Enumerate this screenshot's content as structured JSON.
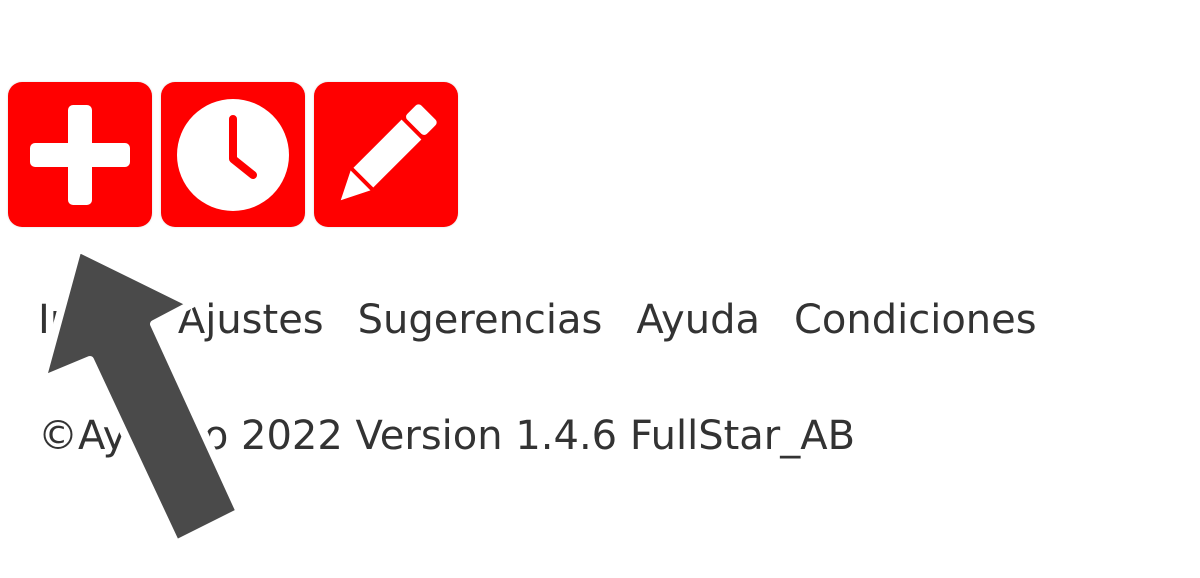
{
  "colors": {
    "button_bg": "#ff0000",
    "icon_fg": "#ffffff",
    "text": "#333333",
    "arrow_fill": "#4a4a4a",
    "arrow_stroke": "#ffffff"
  },
  "toolbar": {
    "buttons": [
      {
        "icon": "plus-icon"
      },
      {
        "icon": "clock-icon"
      },
      {
        "icon": "pencil-icon"
      }
    ]
  },
  "footer": {
    "links": [
      "Inicio",
      "Ajustes",
      "Sugerencias",
      "Ayuda",
      "Condiciones"
    ],
    "copyright": "©Ayuntio 2022 Version 1.4.6 FullStar_AB"
  },
  "overlay": {
    "arrow_icon": "pointer-arrow-icon"
  }
}
